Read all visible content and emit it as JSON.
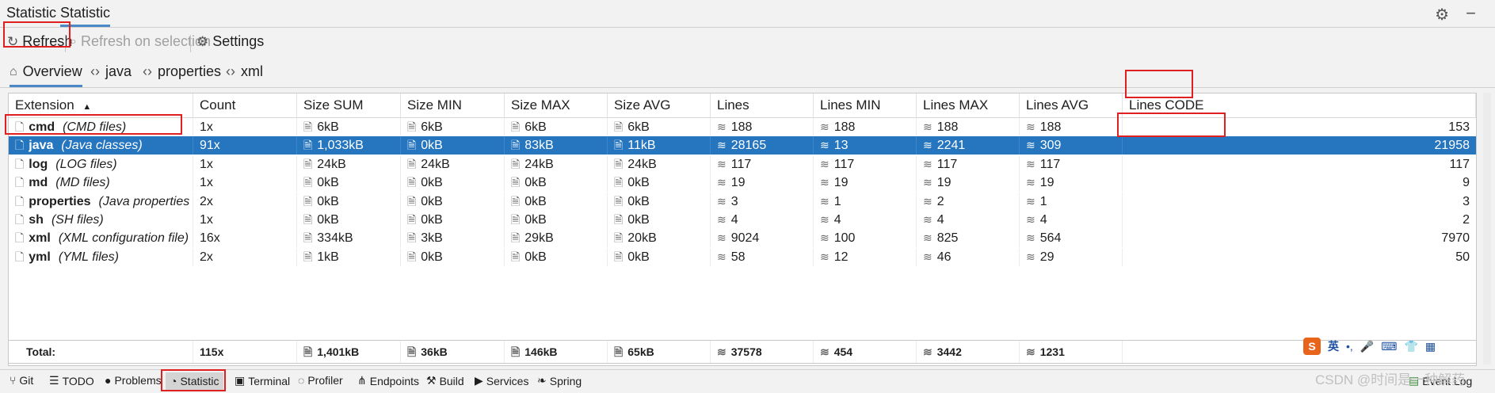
{
  "top_tabs": [
    "Statistic",
    "Statistic"
  ],
  "toolbar": {
    "refresh_label": "Refresh",
    "refresh_on_selection_label": "Refresh on selection",
    "settings_label": "Settings"
  },
  "sub_tabs": [
    "Overview",
    "java",
    "properties",
    "xml"
  ],
  "table": {
    "columns": [
      "Extension",
      "Count",
      "Size SUM",
      "Size MIN",
      "Size MAX",
      "Size AVG",
      "Lines",
      "Lines MIN",
      "Lines MAX",
      "Lines AVG",
      "Lines CODE"
    ],
    "sort_indicator": "▲",
    "rows": [
      {
        "name": "cmd",
        "desc": "(CMD files)",
        "count": "1x",
        "size_sum": "6kB",
        "size_min": "6kB",
        "size_max": "6kB",
        "size_avg": "6kB",
        "lines": "188",
        "lines_min": "188",
        "lines_max": "188",
        "lines_avg": "188",
        "lines_code": "153"
      },
      {
        "name": "java",
        "desc": "(Java classes)",
        "count": "91x",
        "size_sum": "1,033kB",
        "size_min": "0kB",
        "size_max": "83kB",
        "size_avg": "11kB",
        "lines": "28165",
        "lines_min": "13",
        "lines_max": "2241",
        "lines_avg": "309",
        "lines_code": "21958"
      },
      {
        "name": "log",
        "desc": "(LOG files)",
        "count": "1x",
        "size_sum": "24kB",
        "size_min": "24kB",
        "size_max": "24kB",
        "size_avg": "24kB",
        "lines": "117",
        "lines_min": "117",
        "lines_max": "117",
        "lines_avg": "117",
        "lines_code": "117"
      },
      {
        "name": "md",
        "desc": "(MD files)",
        "count": "1x",
        "size_sum": "0kB",
        "size_min": "0kB",
        "size_max": "0kB",
        "size_avg": "0kB",
        "lines": "19",
        "lines_min": "19",
        "lines_max": "19",
        "lines_avg": "19",
        "lines_code": "9"
      },
      {
        "name": "properties",
        "desc": "(Java properties",
        "count": "2x",
        "size_sum": "0kB",
        "size_min": "0kB",
        "size_max": "0kB",
        "size_avg": "0kB",
        "lines": "3",
        "lines_min": "1",
        "lines_max": "2",
        "lines_avg": "1",
        "lines_code": "3"
      },
      {
        "name": "sh",
        "desc": "(SH files)",
        "count": "1x",
        "size_sum": "0kB",
        "size_min": "0kB",
        "size_max": "0kB",
        "size_avg": "0kB",
        "lines": "4",
        "lines_min": "4",
        "lines_max": "4",
        "lines_avg": "4",
        "lines_code": "2"
      },
      {
        "name": "xml",
        "desc": "(XML configuration file)",
        "count": "16x",
        "size_sum": "334kB",
        "size_min": "3kB",
        "size_max": "29kB",
        "size_avg": "20kB",
        "lines": "9024",
        "lines_min": "100",
        "lines_max": "825",
        "lines_avg": "564",
        "lines_code": "7970"
      },
      {
        "name": "yml",
        "desc": "(YML files)",
        "count": "2x",
        "size_sum": "1kB",
        "size_min": "0kB",
        "size_max": "0kB",
        "size_avg": "0kB",
        "lines": "58",
        "lines_min": "12",
        "lines_max": "46",
        "lines_avg": "29",
        "lines_code": "50"
      }
    ],
    "selected_row": "java",
    "totals": {
      "label": "Total:",
      "count": "115x",
      "size_sum": "1,401kB",
      "size_min": "36kB",
      "size_max": "146kB",
      "size_avg": "65kB",
      "lines": "37578",
      "lines_min": "454",
      "lines_max": "3442",
      "lines_avg": "1231"
    }
  },
  "bottom_bar": [
    "Git",
    "TODO",
    "Problems",
    "Statistic",
    "Terminal",
    "Profiler",
    "Endpoints",
    "Build",
    "Services",
    "Spring"
  ],
  "event_log": "Event Log",
  "ime": {
    "logo": "S",
    "lang": "英"
  },
  "watermark": "CSDN @时间是一种解药",
  "colors": {
    "selection": "#2675bf",
    "highlight_box": "#e02020",
    "tab_underline": "#4a88c7"
  }
}
